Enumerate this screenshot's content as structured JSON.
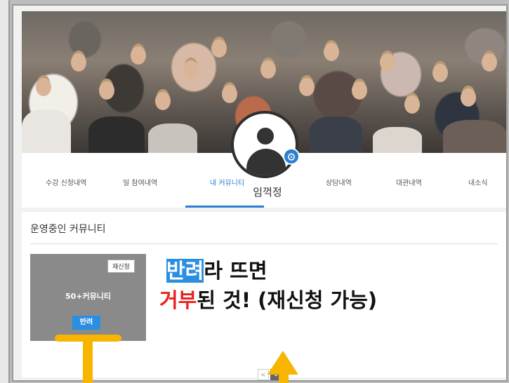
{
  "profile": {
    "username": "임꺽정"
  },
  "tabs": [
    {
      "label": "수강 신청내역"
    },
    {
      "label": "일 참여내역"
    },
    {
      "label": "내 커뮤니티"
    },
    {
      "label": "상담내역"
    },
    {
      "label": "대관내역"
    },
    {
      "label": "내소식"
    }
  ],
  "community": {
    "section_title": "운영중인 커뮤니티",
    "card": {
      "name": "50+커뮤니티",
      "reapply_label": "재신청",
      "status_button": "반려"
    }
  },
  "annotation": {
    "line1_highlight": "반려",
    "line1_rest": "라 뜨면",
    "line2_highlight": "거부",
    "line2_rest": "된 것! (재신청 가능)"
  },
  "pagination": {
    "prev": "<",
    "current": "1"
  },
  "colors": {
    "accent": "#2a7fd0",
    "annotation_red": "#e8221e",
    "arrow": "#f7b500"
  }
}
